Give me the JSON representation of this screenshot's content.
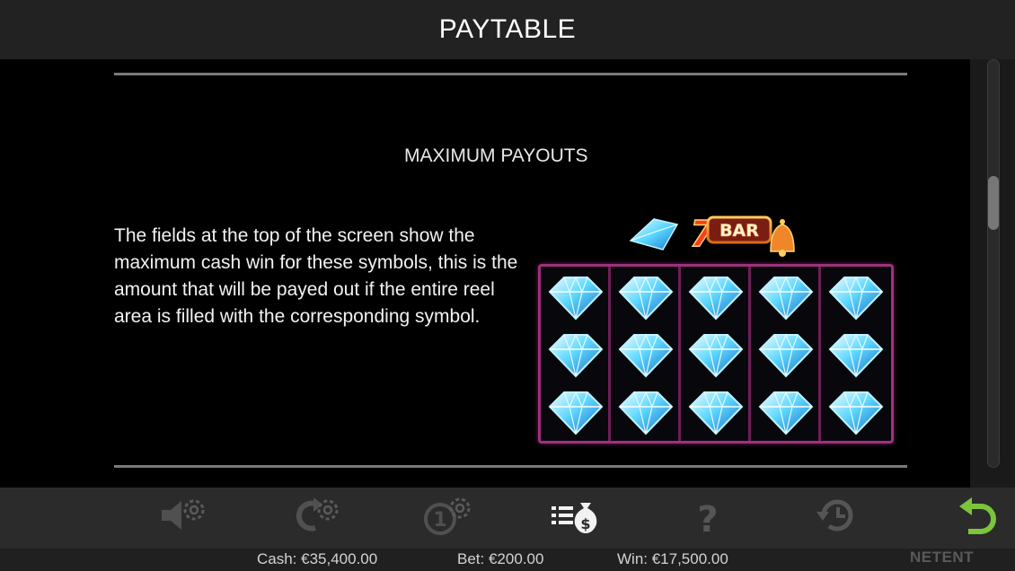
{
  "header": {
    "title": "PAYTABLE"
  },
  "section": {
    "title": "MAXIMUM PAYOUTS",
    "description": "The fields at the top of the screen show the maximum cash win for these symbols, this is the amount that will be payed out if the entire reel area is filled with the corresponding symbol."
  },
  "logo": {
    "text": "BAR",
    "seven": "7"
  },
  "reel": {
    "columns": 5,
    "rows": 3,
    "symbol_icon": "diamond-icon"
  },
  "toolbar": {
    "buttons": [
      {
        "name": "sound-settings-button",
        "icon": "speaker-gear-icon",
        "active": false
      },
      {
        "name": "autoplay-settings-button",
        "icon": "arrows-gear-icon",
        "active": false
      },
      {
        "name": "bet-settings-button",
        "icon": "coin-gear-icon",
        "active": false
      },
      {
        "name": "paytable-button",
        "icon": "paytable-icon",
        "active": true
      },
      {
        "name": "help-button",
        "icon": "question-icon",
        "active": false,
        "label": "?"
      },
      {
        "name": "history-button",
        "icon": "history-icon",
        "active": false
      },
      {
        "name": "back-button",
        "icon": "back-arrow-icon",
        "active": true
      }
    ]
  },
  "footer": {
    "cash": "Cash: €35,400.00",
    "bet": "Bet: €200.00",
    "win": "Win: €17,500.00",
    "brand": "NETENT"
  },
  "colors": {
    "header_bg": "#222222",
    "toolbar_bg": "#2b2b2b",
    "reel_border": "#a0307e",
    "back_arrow": "#7cc43a",
    "diamond": "#4fd2ff"
  }
}
